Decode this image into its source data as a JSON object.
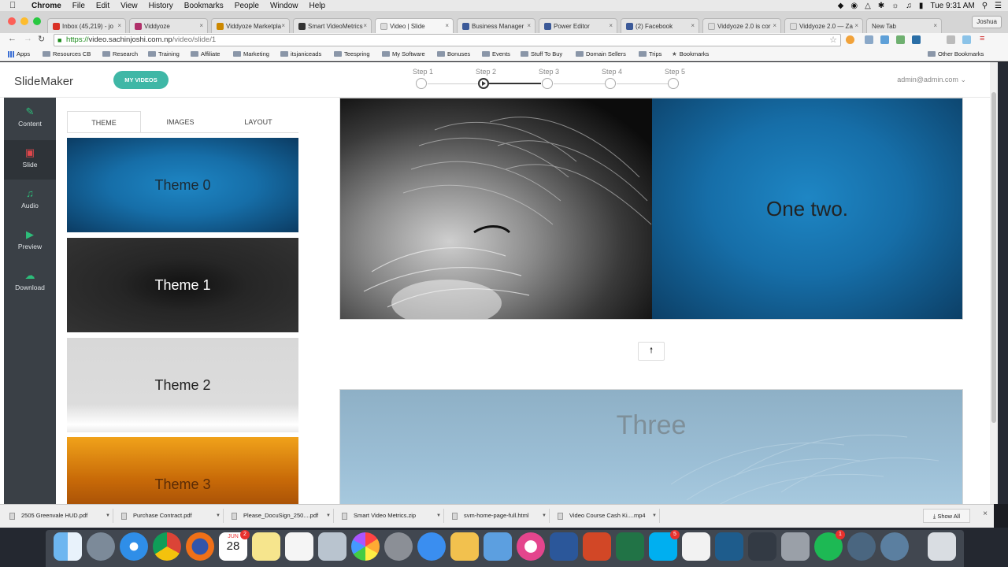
{
  "menubar": {
    "apple": "",
    "items": [
      "Chrome",
      "File",
      "Edit",
      "View",
      "History",
      "Bookmarks",
      "People",
      "Window",
      "Help"
    ],
    "clock": "Tue 9:31 AM"
  },
  "browser": {
    "tabs": [
      {
        "label": "Inbox (45,219) - jo",
        "favicon_color": "#d93025"
      },
      {
        "label": "Viddyoze",
        "favicon_color": "#b0306a"
      },
      {
        "label": "Viddyoze Marketpla",
        "favicon_color": "#cc8800"
      },
      {
        "label": "Smart VideoMetrics",
        "favicon_color": "#333333"
      },
      {
        "label": "Video | Slide",
        "favicon_color": "#dddddd"
      },
      {
        "label": "Business Manager",
        "favicon_color": "#3b5998"
      },
      {
        "label": "Power Editor",
        "favicon_color": "#3b5998"
      },
      {
        "label": "(2) Facebook",
        "favicon_color": "#3b5998"
      },
      {
        "label": "Viddyoze 2.0 is cor",
        "favicon_color": "#dddddd"
      },
      {
        "label": "Viddyoze 2.0 — Za",
        "favicon_color": "#dddddd"
      },
      {
        "label": "New Tab",
        "favicon_color": "#dddddd"
      }
    ],
    "active_tab": 4,
    "profile": "Joshua",
    "url_scheme": "https://",
    "url_host": "video.sachinjoshi.com.np",
    "url_path": "/video/slide/1",
    "bookmarks": [
      "Apps",
      "Resources CB",
      "Research",
      "Training",
      "Affiliate",
      "Marketing",
      "itsjaniceads",
      "Teespring",
      "My Software",
      "Bonuses",
      "Events",
      "Stuff To Buy",
      "Domain Sellers",
      "Trips",
      "Bookmarks"
    ],
    "other_bookmarks": "Other Bookmarks"
  },
  "app": {
    "logo": "SlideMaker",
    "my_videos": "MY VIDEOS",
    "steps": [
      "Step 1",
      "Step 2",
      "Step 3",
      "Step 4",
      "Step 5"
    ],
    "current_step": 2,
    "user": "admin@admin.com",
    "sidebar": [
      {
        "label": "Content",
        "icon": "edit-icon",
        "color": "#2dbd7a"
      },
      {
        "label": "Slide",
        "icon": "file-icon",
        "color": "#e0474c"
      },
      {
        "label": "Audio",
        "icon": "audio-file-icon",
        "color": "#2dbd7a"
      },
      {
        "label": "Preview",
        "icon": "play-icon",
        "color": "#2dbd7a"
      },
      {
        "label": "Download",
        "icon": "cloud-download-icon",
        "color": "#2dbd7a"
      }
    ],
    "panel_tabs": [
      "THEME",
      "IMAGES",
      "LAYOUT"
    ],
    "themes": [
      "Theme 0",
      "Theme 1",
      "Theme 2",
      "Theme 3"
    ],
    "slides": [
      {
        "text": "One two."
      },
      {
        "text": "Three"
      }
    ],
    "move_up_icon": "arrow-up-icon"
  },
  "downloads": {
    "items": [
      "2505 Greenvale HUD.pdf",
      "Purchase Contract.pdf",
      "Please_DocuSign_250....pdf",
      "Smart Video Metrics.zip",
      "svm-home-page-full.html",
      "Video Course Cash Ki....mp4"
    ],
    "show_all": "Show All"
  },
  "dock": {
    "calendar_month": "JUN",
    "calendar_day": "28",
    "badges": {
      "calendar": "2",
      "skype": "5",
      "spotify": "1"
    }
  }
}
